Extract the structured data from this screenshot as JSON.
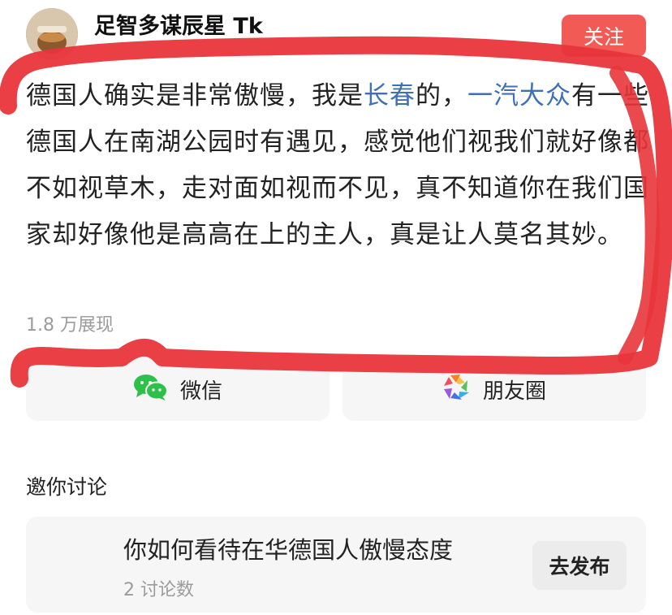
{
  "post": {
    "author": "足智多谋辰星 Tk",
    "follow_label": "关注",
    "body_1": "德国人确实是非常傲慢，我是",
    "link_1": "长春",
    "body_2": "的，",
    "link_2": "一汽大众",
    "body_3": "有一些德国人在南湖公园时有遇见，感觉他们视我们就好像都不如视草木，走对面如视而不见，真不知道你在我们国家却好像他是高高在上的主人，真是让人莫名其妙。",
    "views": "1.8 万展现"
  },
  "share": {
    "wechat_label": "微信",
    "moments_label": "朋友圈"
  },
  "discussion": {
    "section_title": "邀你讨论",
    "topic_title": "你如何看待在华德国人傲慢态度",
    "topic_count": "2 讨论数",
    "publish_label": "去发布"
  },
  "colors": {
    "follow": "#f25a55",
    "link": "#3f6fb6",
    "annotation": "#e8353b"
  },
  "icons": {
    "wechat": "wechat-icon",
    "moments": "moments-icon"
  }
}
